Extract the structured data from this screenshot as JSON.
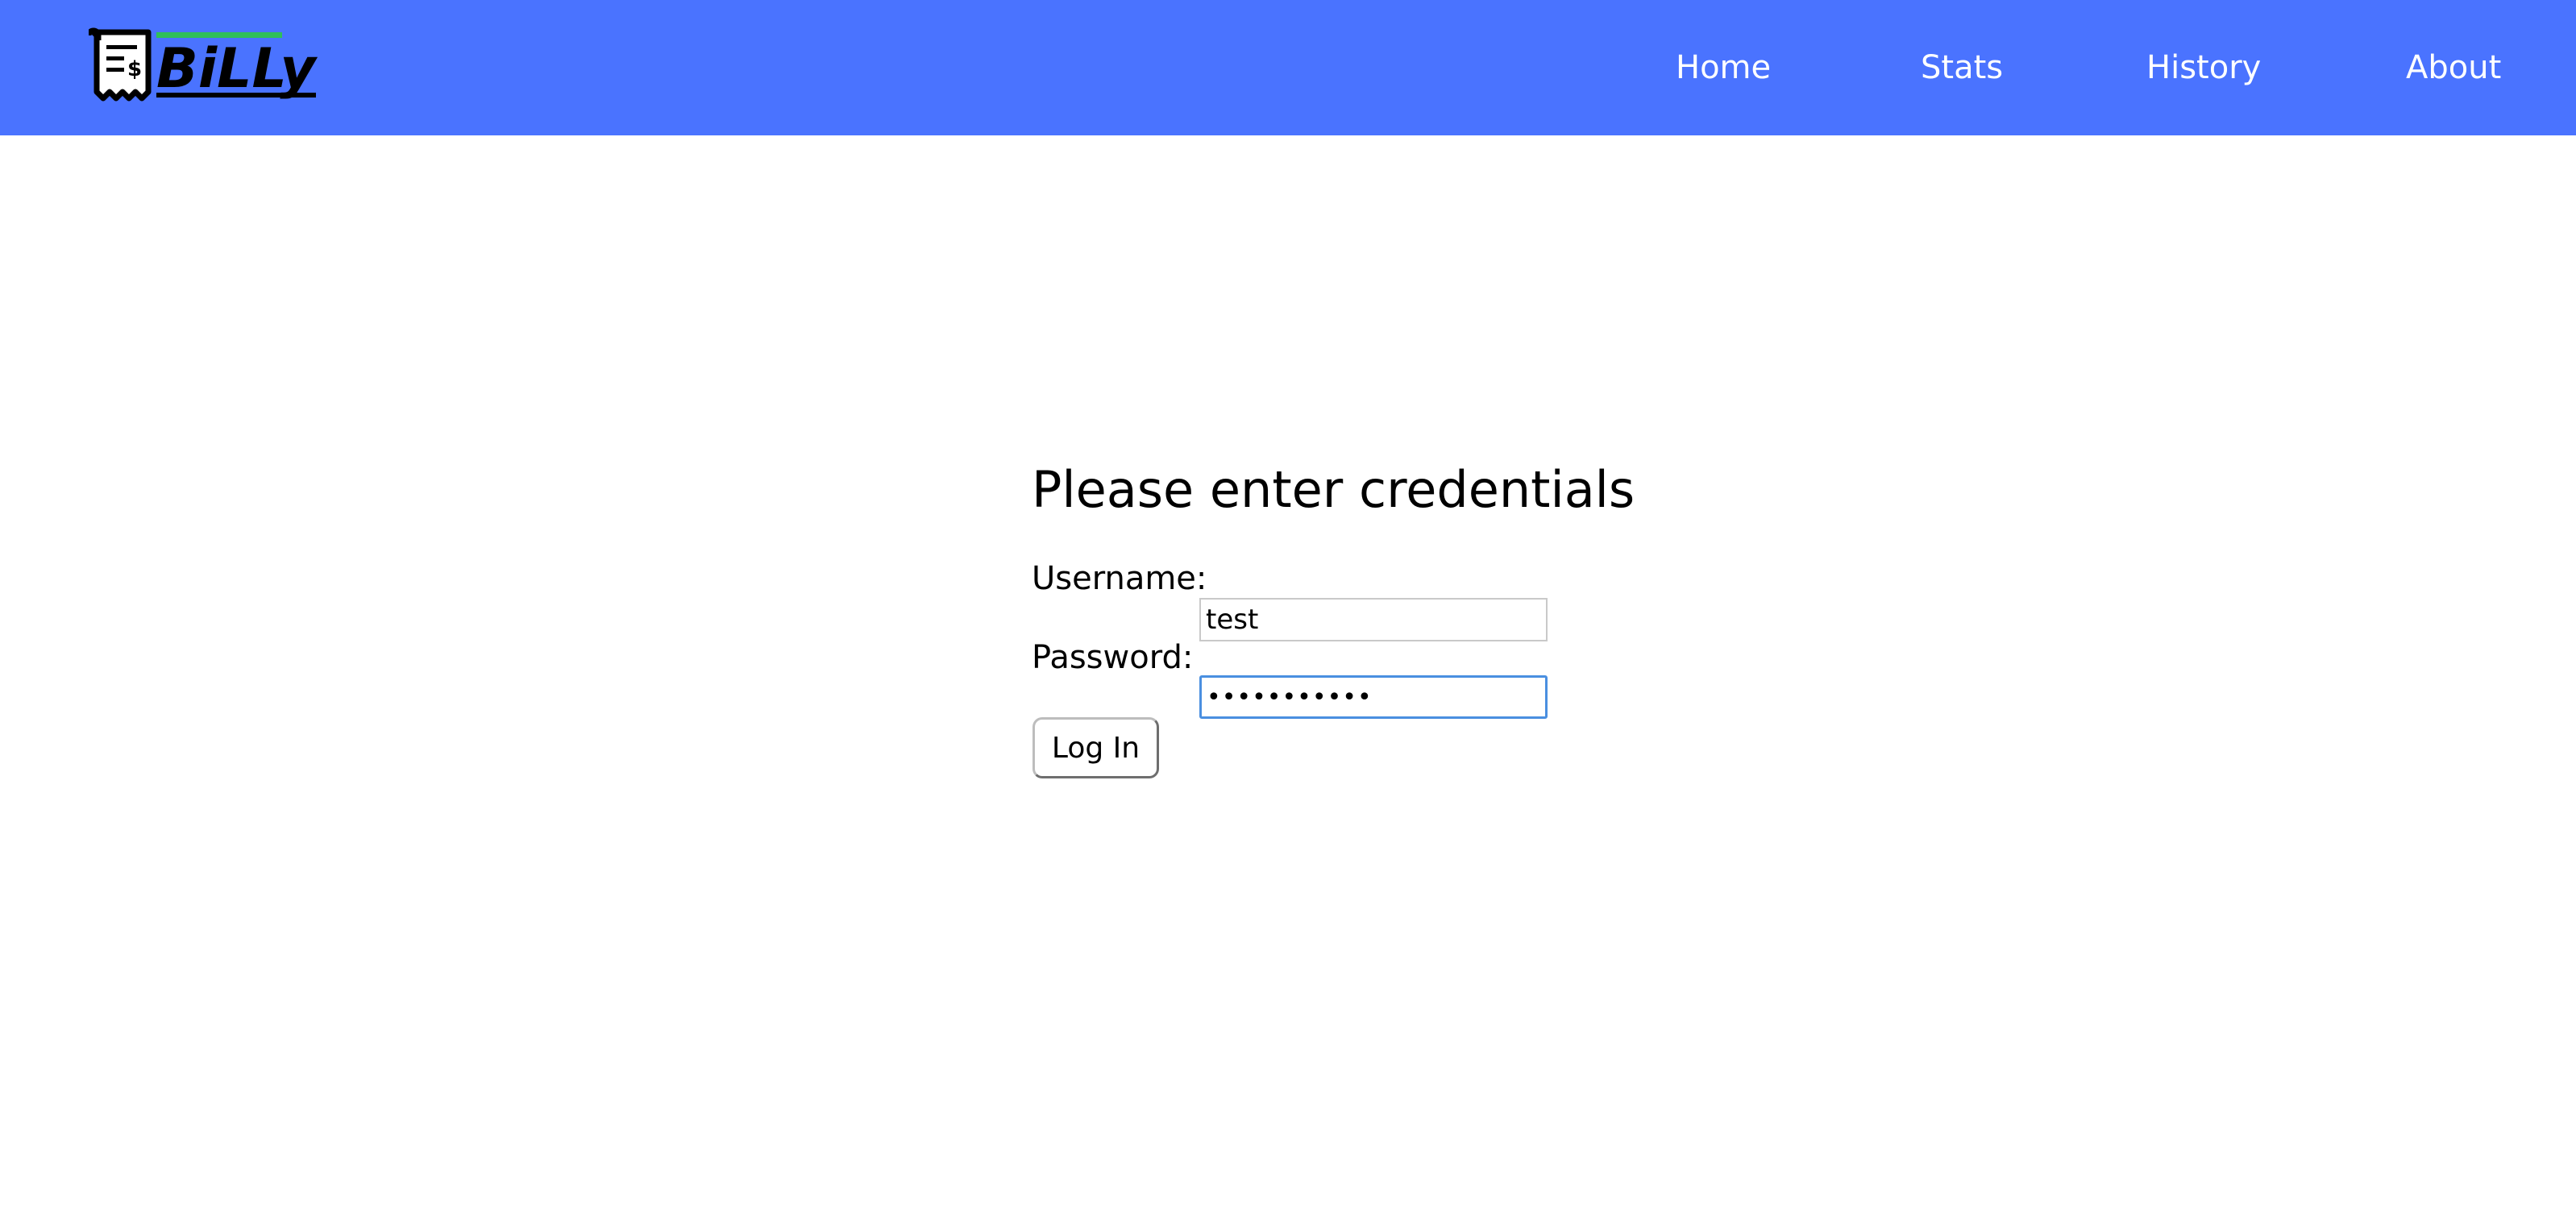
{
  "app": {
    "logo_text": "BiLLy",
    "brand_color": "#4a73ff",
    "logo_accent_color": "#2fbf5a"
  },
  "nav": {
    "items": [
      {
        "label": "Home"
      },
      {
        "label": "Stats"
      },
      {
        "label": "History"
      },
      {
        "label": "About"
      }
    ]
  },
  "login": {
    "heading": "Please enter credentials",
    "username_label": "Username:",
    "username_value": "test",
    "password_label": "Password:",
    "password_value": "•••••••••••",
    "submit_label": "Log In",
    "focus_color": "#4a8fe0"
  },
  "icons": {
    "logo_icon": "receipt-dollar-icon"
  }
}
